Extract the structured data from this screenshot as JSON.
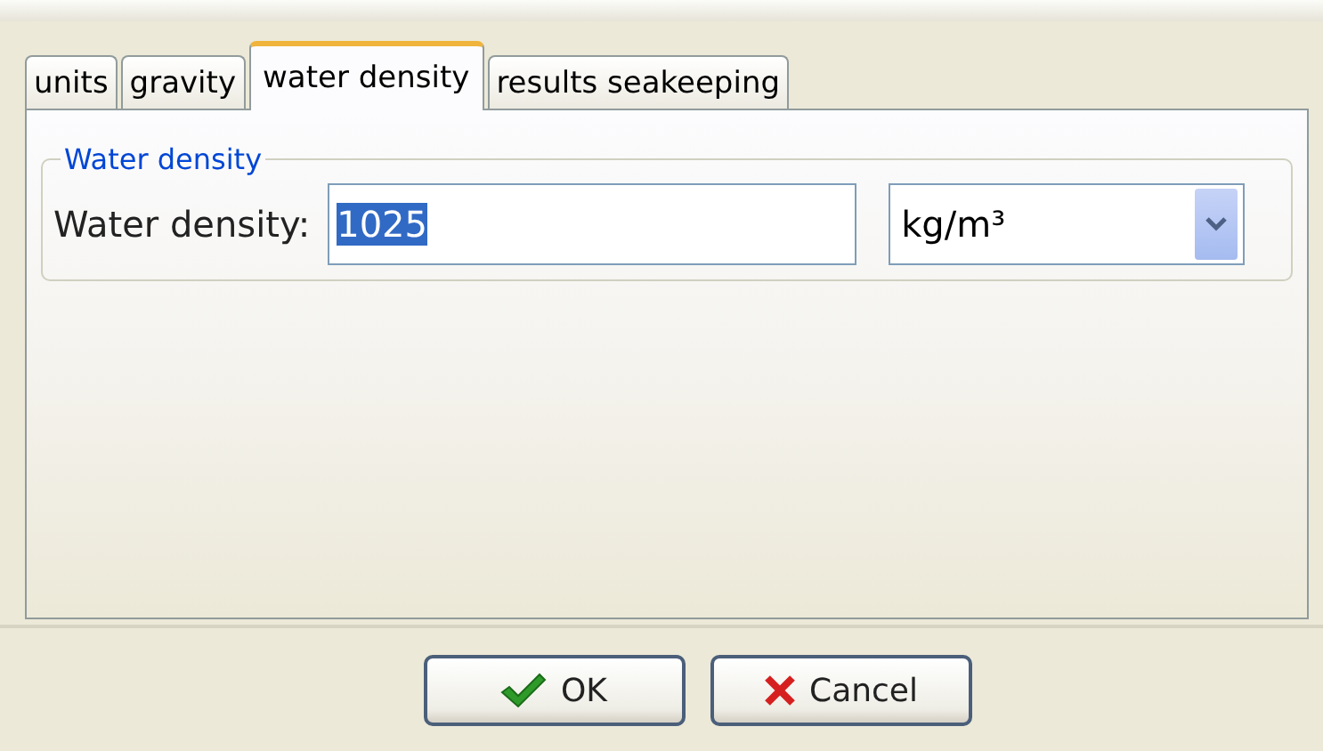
{
  "tabs": [
    {
      "label": "units",
      "selected": false
    },
    {
      "label": "gravity",
      "selected": false
    },
    {
      "label": "water density",
      "selected": true
    },
    {
      "label": "results seakeeping",
      "selected": false
    }
  ],
  "group": {
    "title": "Water density",
    "label": "Water density:",
    "value": "1025",
    "value_selected": true,
    "unit": "kg/m³"
  },
  "buttons": [
    {
      "kind": "ok",
      "label": "OK"
    },
    {
      "kind": "cancel",
      "label": "Cancel"
    }
  ]
}
